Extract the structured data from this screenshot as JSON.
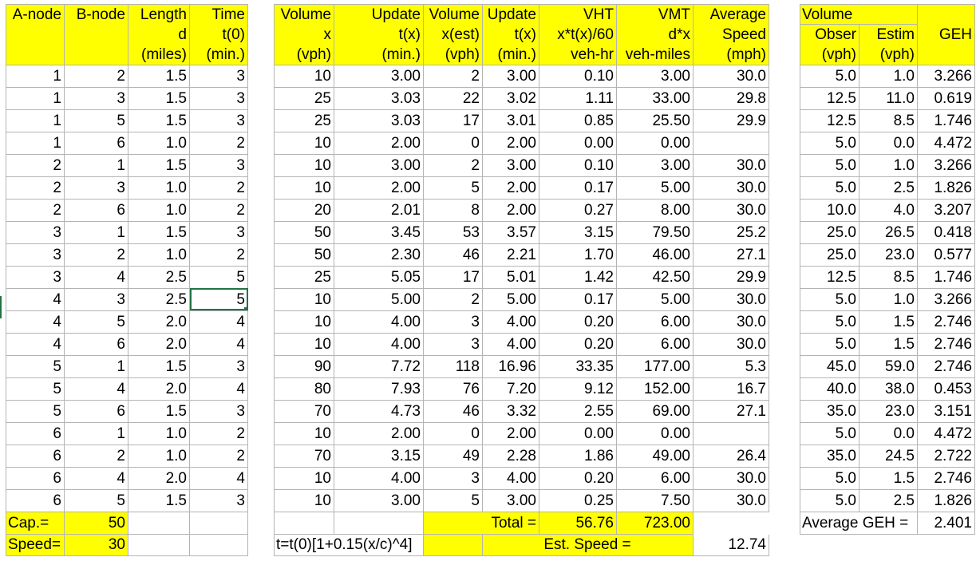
{
  "block1": {
    "headers": [
      [
        "A-node",
        "B-node",
        "Length",
        "Time"
      ],
      [
        "",
        "",
        "d",
        "t(0)"
      ],
      [
        "",
        "",
        "(miles)",
        "(min.)"
      ]
    ],
    "rows": [
      [
        "1",
        "2",
        "1.5",
        "3"
      ],
      [
        "1",
        "3",
        "1.5",
        "3"
      ],
      [
        "1",
        "5",
        "1.5",
        "3"
      ],
      [
        "1",
        "6",
        "1.0",
        "2"
      ],
      [
        "2",
        "1",
        "1.5",
        "3"
      ],
      [
        "2",
        "3",
        "1.0",
        "2"
      ],
      [
        "2",
        "6",
        "1.0",
        "2"
      ],
      [
        "3",
        "1",
        "1.5",
        "3"
      ],
      [
        "3",
        "2",
        "1.0",
        "2"
      ],
      [
        "3",
        "4",
        "2.5",
        "5"
      ],
      [
        "4",
        "3",
        "2.5",
        "5"
      ],
      [
        "4",
        "5",
        "2.0",
        "4"
      ],
      [
        "4",
        "6",
        "2.0",
        "4"
      ],
      [
        "5",
        "1",
        "1.5",
        "3"
      ],
      [
        "5",
        "4",
        "2.0",
        "4"
      ],
      [
        "5",
        "6",
        "1.5",
        "3"
      ],
      [
        "6",
        "1",
        "1.0",
        "2"
      ],
      [
        "6",
        "2",
        "1.0",
        "2"
      ],
      [
        "6",
        "4",
        "2.0",
        "4"
      ],
      [
        "6",
        "5",
        "1.5",
        "3"
      ]
    ],
    "footer": [
      [
        "Cap.=",
        "50"
      ],
      [
        "Speed=",
        "30"
      ]
    ]
  },
  "block2": {
    "headers": [
      [
        "Volume",
        "Update"
      ],
      [
        "x",
        "t(x)"
      ],
      [
        "(vph)",
        "(min.)"
      ]
    ],
    "rows": [
      [
        "10",
        "3.00"
      ],
      [
        "25",
        "3.03"
      ],
      [
        "25",
        "3.03"
      ],
      [
        "10",
        "2.00"
      ],
      [
        "10",
        "3.00"
      ],
      [
        "10",
        "2.00"
      ],
      [
        "20",
        "2.01"
      ],
      [
        "50",
        "3.45"
      ],
      [
        "50",
        "2.30"
      ],
      [
        "25",
        "5.05"
      ],
      [
        "10",
        "5.00"
      ],
      [
        "10",
        "4.00"
      ],
      [
        "10",
        "4.00"
      ],
      [
        "90",
        "7.72"
      ],
      [
        "80",
        "7.93"
      ],
      [
        "70",
        "4.73"
      ],
      [
        "10",
        "2.00"
      ],
      [
        "70",
        "3.15"
      ],
      [
        "10",
        "4.00"
      ],
      [
        "10",
        "3.00"
      ]
    ],
    "formula": "t=t(0)[1+0.15(x/c)^4]"
  },
  "block3": {
    "headers": [
      [
        "Volume",
        "Update",
        "VHT",
        "VMT",
        "Average"
      ],
      [
        "x(est)",
        "t(x)",
        "x*t(x)/60",
        "d*x",
        "Speed"
      ],
      [
        "(vph)",
        "(min.)",
        "veh-hr",
        "veh-miles",
        "(mph)"
      ]
    ],
    "rows": [
      [
        "2",
        "3.00",
        "0.10",
        "3.00",
        "30.0"
      ],
      [
        "22",
        "3.02",
        "1.11",
        "33.00",
        "29.8"
      ],
      [
        "17",
        "3.01",
        "0.85",
        "25.50",
        "29.9"
      ],
      [
        "0",
        "2.00",
        "0.00",
        "0.00",
        ""
      ],
      [
        "2",
        "3.00",
        "0.10",
        "3.00",
        "30.0"
      ],
      [
        "5",
        "2.00",
        "0.17",
        "5.00",
        "30.0"
      ],
      [
        "8",
        "2.00",
        "0.27",
        "8.00",
        "30.0"
      ],
      [
        "53",
        "3.57",
        "3.15",
        "79.50",
        "25.2"
      ],
      [
        "46",
        "2.21",
        "1.70",
        "46.00",
        "27.1"
      ],
      [
        "17",
        "5.01",
        "1.42",
        "42.50",
        "29.9"
      ],
      [
        "2",
        "5.00",
        "0.17",
        "5.00",
        "30.0"
      ],
      [
        "3",
        "4.00",
        "0.20",
        "6.00",
        "30.0"
      ],
      [
        "3",
        "4.00",
        "0.20",
        "6.00",
        "30.0"
      ],
      [
        "118",
        "16.96",
        "33.35",
        "177.00",
        "5.3"
      ],
      [
        "76",
        "7.20",
        "9.12",
        "152.00",
        "16.7"
      ],
      [
        "46",
        "3.32",
        "2.55",
        "69.00",
        "27.1"
      ],
      [
        "0",
        "2.00",
        "0.00",
        "0.00",
        ""
      ],
      [
        "49",
        "2.28",
        "1.86",
        "49.00",
        "26.4"
      ],
      [
        "3",
        "4.00",
        "0.20",
        "6.00",
        "30.0"
      ],
      [
        "5",
        "3.00",
        "0.25",
        "7.50",
        "30.0"
      ]
    ],
    "total_label": "Total =",
    "total_vht": "56.76",
    "total_vmt": "723.00",
    "est_speed_label": "Est. Speed =",
    "est_speed_value": "12.74"
  },
  "block4": {
    "headers": [
      [
        "Volume",
        "",
        "GEH"
      ],
      [
        "Obser",
        "Estim",
        ""
      ],
      [
        "(vph)",
        "(vph)",
        ""
      ]
    ],
    "rows": [
      [
        "5.0",
        "1.0",
        "3.266"
      ],
      [
        "12.5",
        "11.0",
        "0.619"
      ],
      [
        "12.5",
        "8.5",
        "1.746"
      ],
      [
        "5.0",
        "0.0",
        "4.472"
      ],
      [
        "5.0",
        "1.0",
        "3.266"
      ],
      [
        "5.0",
        "2.5",
        "1.826"
      ],
      [
        "10.0",
        "4.0",
        "3.207"
      ],
      [
        "25.0",
        "26.5",
        "0.418"
      ],
      [
        "25.0",
        "23.0",
        "0.577"
      ],
      [
        "12.5",
        "8.5",
        "1.746"
      ],
      [
        "5.0",
        "1.0",
        "3.266"
      ],
      [
        "5.0",
        "1.5",
        "2.746"
      ],
      [
        "5.0",
        "1.5",
        "2.746"
      ],
      [
        "45.0",
        "59.0",
        "2.746"
      ],
      [
        "40.0",
        "38.0",
        "0.453"
      ],
      [
        "35.0",
        "23.0",
        "3.151"
      ],
      [
        "5.0",
        "0.0",
        "4.472"
      ],
      [
        "35.0",
        "24.5",
        "2.722"
      ],
      [
        "5.0",
        "1.5",
        "2.746"
      ],
      [
        "5.0",
        "2.5",
        "1.826"
      ]
    ],
    "avg_label": "Average GEH =",
    "avg_value": "2.401"
  },
  "selected_cell": {
    "row": 10,
    "col": 3
  },
  "colors": {
    "header_fill": "#ffff00",
    "gridline": "#b4b4b4",
    "selection": "#217346"
  }
}
